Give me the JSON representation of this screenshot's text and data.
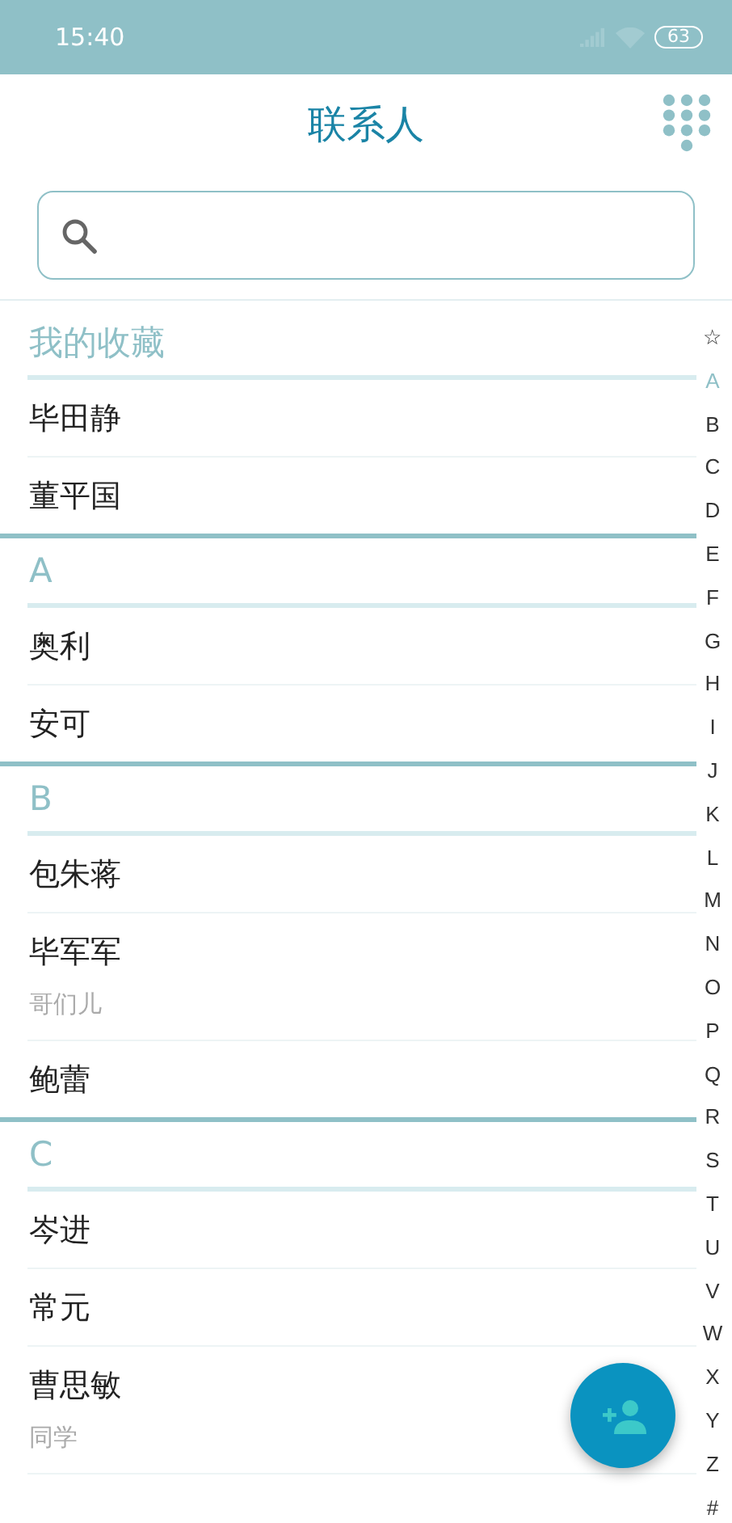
{
  "status_bar": {
    "time": "15:40",
    "battery": "63"
  },
  "header": {
    "title": "联系人"
  },
  "sections": [
    {
      "title": "我的收藏",
      "contacts": [
        {
          "name": "毕田静"
        },
        {
          "name": "董平国"
        }
      ]
    },
    {
      "title": "A",
      "contacts": [
        {
          "name": "奥利"
        },
        {
          "name": "安可"
        }
      ]
    },
    {
      "title": "B",
      "contacts": [
        {
          "name": "包朱蒋"
        },
        {
          "name": "毕军军",
          "note": "哥们儿"
        },
        {
          "name": "鲍蕾"
        }
      ]
    },
    {
      "title": "C",
      "contacts": [
        {
          "name": "岑进"
        },
        {
          "name": "常元"
        },
        {
          "name": "曹思敏",
          "note": "同学"
        }
      ]
    }
  ],
  "index": [
    {
      "label": "☆",
      "selected": false
    },
    {
      "label": "A",
      "selected": true
    },
    {
      "label": "B",
      "selected": false
    },
    {
      "label": "C",
      "selected": false
    },
    {
      "label": "D",
      "selected": false
    },
    {
      "label": "E",
      "selected": false
    },
    {
      "label": "F",
      "selected": false
    },
    {
      "label": "G",
      "selected": false
    },
    {
      "label": "H",
      "selected": false
    },
    {
      "label": "I",
      "selected": false
    },
    {
      "label": "J",
      "selected": false
    },
    {
      "label": "K",
      "selected": false
    },
    {
      "label": "L",
      "selected": false
    },
    {
      "label": "M",
      "selected": false
    },
    {
      "label": "N",
      "selected": false
    },
    {
      "label": "O",
      "selected": false
    },
    {
      "label": "P",
      "selected": false
    },
    {
      "label": "Q",
      "selected": false
    },
    {
      "label": "R",
      "selected": false
    },
    {
      "label": "S",
      "selected": false
    },
    {
      "label": "T",
      "selected": false
    },
    {
      "label": "U",
      "selected": false
    },
    {
      "label": "V",
      "selected": false
    },
    {
      "label": "W",
      "selected": false
    },
    {
      "label": "X",
      "selected": false
    },
    {
      "label": "Y",
      "selected": false
    },
    {
      "label": "Z",
      "selected": false
    },
    {
      "label": "#",
      "selected": false
    }
  ]
}
